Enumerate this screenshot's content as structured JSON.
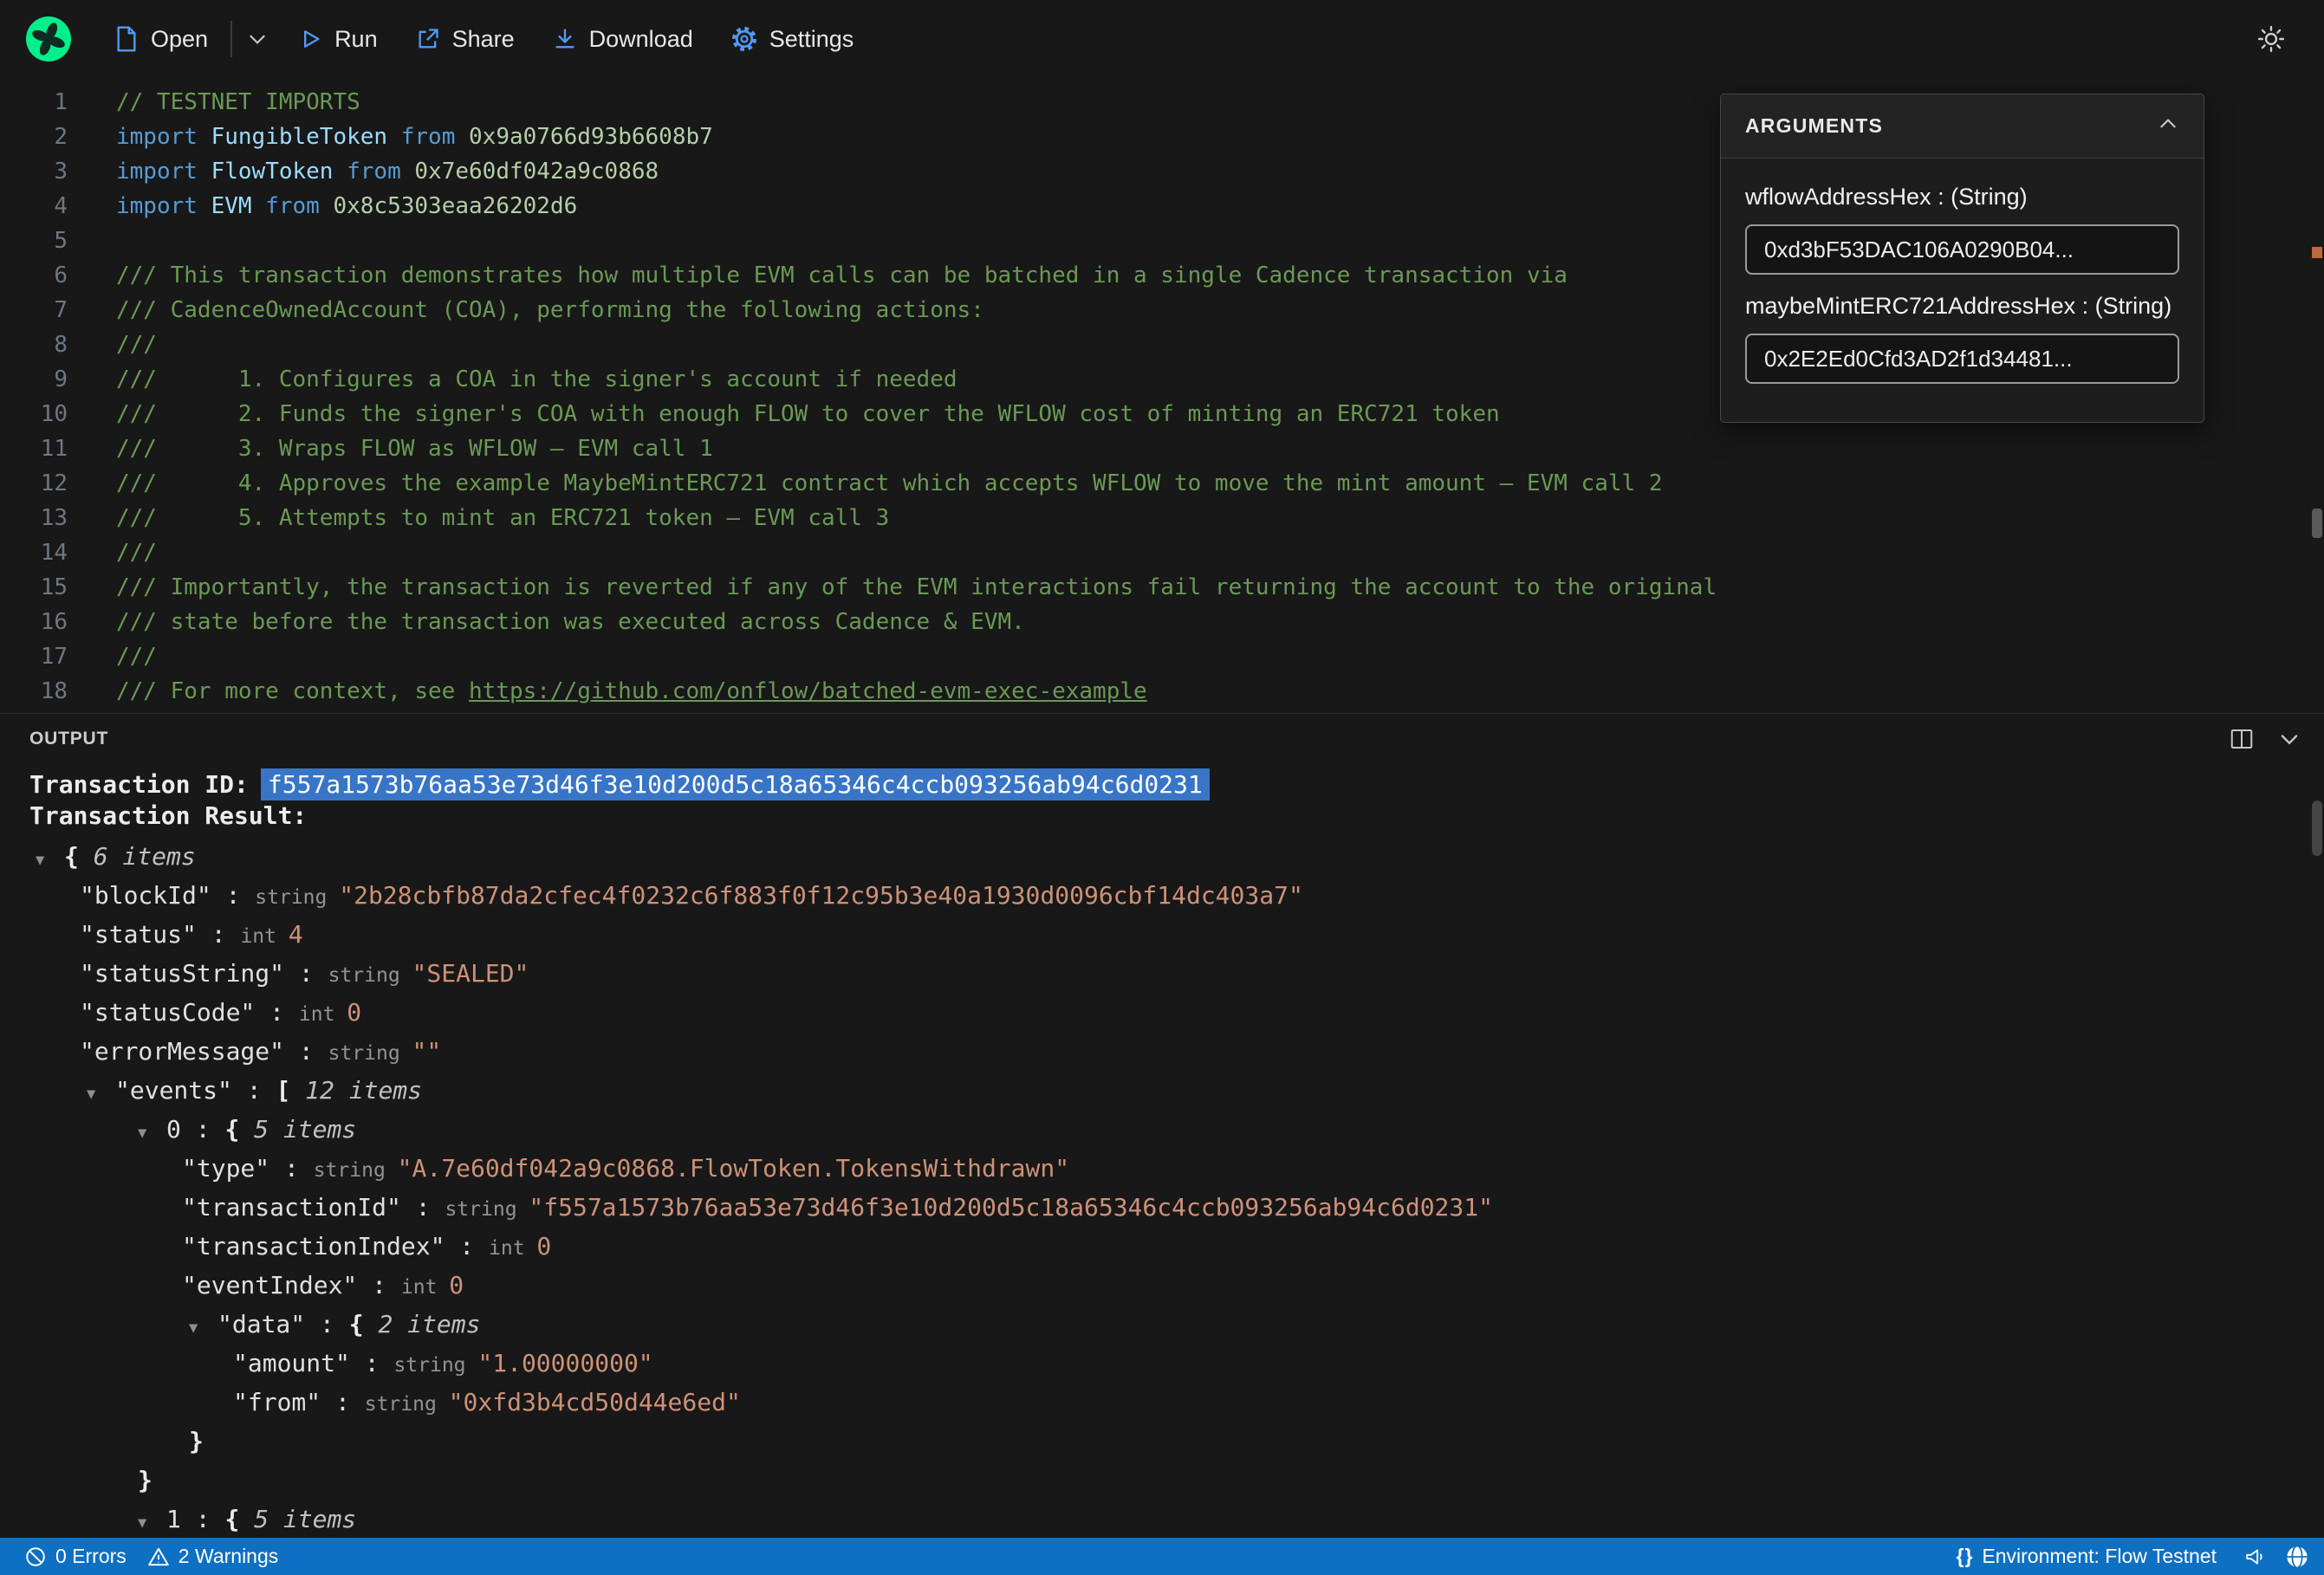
{
  "colors": {
    "brand_green": "#00ef8b",
    "icon_blue": "#519af5",
    "statusbar_blue": "#0e70c2",
    "selection_blue": "#3875c7",
    "comment_green": "#6a9955",
    "string_orange": "#ce9178"
  },
  "toolbar": {
    "open": "Open",
    "run": "Run",
    "share": "Share",
    "download": "Download",
    "settings": "Settings"
  },
  "editor": {
    "lines": [
      {
        "n": "1",
        "tokens": [
          [
            "c",
            "// TESTNET IMPORTS"
          ]
        ]
      },
      {
        "n": "2",
        "tokens": [
          [
            "k",
            "import "
          ],
          [
            "i",
            "FungibleToken "
          ],
          [
            "k",
            "from "
          ],
          [
            "a",
            "0x9a0766d93b6608b7"
          ]
        ]
      },
      {
        "n": "3",
        "tokens": [
          [
            "k",
            "import "
          ],
          [
            "i",
            "FlowToken "
          ],
          [
            "k",
            "from "
          ],
          [
            "a",
            "0x7e60df042a9c0868"
          ]
        ]
      },
      {
        "n": "4",
        "tokens": [
          [
            "k",
            "import "
          ],
          [
            "i",
            "EVM "
          ],
          [
            "k",
            "from "
          ],
          [
            "a",
            "0x8c5303eaa26202d6"
          ]
        ]
      },
      {
        "n": "5",
        "tokens": []
      },
      {
        "n": "6",
        "tokens": [
          [
            "c",
            "/// This transaction demonstrates how multiple EVM calls can be batched in a single Cadence transaction via"
          ]
        ]
      },
      {
        "n": "7",
        "tokens": [
          [
            "c",
            "/// CadenceOwnedAccount (COA), performing the following actions:"
          ]
        ]
      },
      {
        "n": "8",
        "tokens": [
          [
            "c",
            "///"
          ]
        ]
      },
      {
        "n": "9",
        "tokens": [
          [
            "c",
            "///      1. Configures a COA in the signer's account if needed"
          ]
        ]
      },
      {
        "n": "10",
        "tokens": [
          [
            "c",
            "///      2. Funds the signer's COA with enough FLOW to cover the WFLOW cost of minting an ERC721 token"
          ]
        ]
      },
      {
        "n": "11",
        "tokens": [
          [
            "c",
            "///      3. Wraps FLOW as WFLOW — EVM call 1"
          ]
        ]
      },
      {
        "n": "12",
        "tokens": [
          [
            "c",
            "///      4. Approves the example MaybeMintERC721 contract which accepts WFLOW to move the mint amount — EVM call 2"
          ]
        ]
      },
      {
        "n": "13",
        "tokens": [
          [
            "c",
            "///      5. Attempts to mint an ERC721 token — EVM call 3"
          ]
        ]
      },
      {
        "n": "14",
        "tokens": [
          [
            "c",
            "///"
          ]
        ]
      },
      {
        "n": "15",
        "tokens": [
          [
            "c",
            "/// Importantly, the transaction is reverted if any of the EVM interactions fail returning the account to the original"
          ]
        ]
      },
      {
        "n": "16",
        "tokens": [
          [
            "c",
            "/// state before the transaction was executed across Cadence & EVM."
          ]
        ]
      },
      {
        "n": "17",
        "tokens": [
          [
            "c",
            "///"
          ]
        ]
      },
      {
        "n": "18",
        "tokens": [
          [
            "c",
            "/// For more context, see "
          ],
          [
            "l",
            "https://github.com/onflow/batched-evm-exec-example"
          ]
        ]
      }
    ]
  },
  "arguments_panel": {
    "title": "ARGUMENTS",
    "fields": [
      {
        "label": "wflowAddressHex : (String)",
        "value": "0xd3bF53DAC106A0290B04..."
      },
      {
        "label": "maybeMintERC721AddressHex : (String)",
        "value": "0x2E2Ed0Cfd3AD2f1d34481..."
      }
    ]
  },
  "output": {
    "title": "OUTPUT",
    "transaction_id_label": "Transaction ID:",
    "transaction_id": "f557a1573b76aa53e73d46f3e10d200d5c18a65346c4ccb093256ab94c6d0231",
    "transaction_result_label": "Transaction Result:",
    "tree": [
      {
        "i": 0,
        "a": true,
        "seg": [
          [
            "punct",
            "{ "
          ],
          [
            "count",
            "6 items"
          ]
        ]
      },
      {
        "i": 1,
        "seg": [
          [
            "key",
            "\"blockId\""
          ],
          [
            "colon",
            " : "
          ],
          [
            "type",
            "string "
          ],
          [
            "str",
            "\"2b28cbfb87da2cfec4f0232c6f883f0f12c95b3e40a1930d0096cbf14dc403a7\""
          ]
        ]
      },
      {
        "i": 1,
        "seg": [
          [
            "key",
            "\"status\""
          ],
          [
            "colon",
            " : "
          ],
          [
            "type",
            "int "
          ],
          [
            "num",
            "4"
          ]
        ]
      },
      {
        "i": 1,
        "seg": [
          [
            "key",
            "\"statusString\""
          ],
          [
            "colon",
            " : "
          ],
          [
            "type",
            "string "
          ],
          [
            "str",
            "\"SEALED\""
          ]
        ]
      },
      {
        "i": 1,
        "seg": [
          [
            "key",
            "\"statusCode\""
          ],
          [
            "colon",
            " : "
          ],
          [
            "type",
            "int "
          ],
          [
            "num",
            "0"
          ]
        ]
      },
      {
        "i": 1,
        "seg": [
          [
            "key",
            "\"errorMessage\""
          ],
          [
            "colon",
            " : "
          ],
          [
            "type",
            "string "
          ],
          [
            "str",
            "\"\""
          ]
        ]
      },
      {
        "i": 1,
        "a": true,
        "seg": [
          [
            "key",
            "\"events\""
          ],
          [
            "colon",
            " : "
          ],
          [
            "punct",
            "[ "
          ],
          [
            "count",
            "12 items"
          ]
        ]
      },
      {
        "i": 2,
        "a": true,
        "seg": [
          [
            "key",
            "0"
          ],
          [
            "colon",
            " : "
          ],
          [
            "punct",
            "{ "
          ],
          [
            "count",
            "5 items"
          ]
        ]
      },
      {
        "i": 3,
        "seg": [
          [
            "key",
            "\"type\""
          ],
          [
            "colon",
            " : "
          ],
          [
            "type",
            "string "
          ],
          [
            "str",
            "\"A.7e60df042a9c0868.FlowToken.TokensWithdrawn\""
          ]
        ]
      },
      {
        "i": 3,
        "seg": [
          [
            "key",
            "\"transactionId\""
          ],
          [
            "colon",
            " : "
          ],
          [
            "type",
            "string "
          ],
          [
            "str",
            "\"f557a1573b76aa53e73d46f3e10d200d5c18a65346c4ccb093256ab94c6d0231\""
          ]
        ]
      },
      {
        "i": 3,
        "seg": [
          [
            "key",
            "\"transactionIndex\""
          ],
          [
            "colon",
            " : "
          ],
          [
            "type",
            "int "
          ],
          [
            "num",
            "0"
          ]
        ]
      },
      {
        "i": 3,
        "seg": [
          [
            "key",
            "\"eventIndex\""
          ],
          [
            "colon",
            " : "
          ],
          [
            "type",
            "int "
          ],
          [
            "num",
            "0"
          ]
        ]
      },
      {
        "i": 3,
        "a": true,
        "seg": [
          [
            "key",
            "\"data\""
          ],
          [
            "colon",
            " : "
          ],
          [
            "punct",
            "{ "
          ],
          [
            "count",
            "2 items"
          ]
        ]
      },
      {
        "i": 4,
        "seg": [
          [
            "key",
            "\"amount\""
          ],
          [
            "colon",
            " : "
          ],
          [
            "type",
            "string "
          ],
          [
            "str",
            "\"1.00000000\""
          ]
        ]
      },
      {
        "i": 4,
        "seg": [
          [
            "key",
            "\"from\""
          ],
          [
            "colon",
            " : "
          ],
          [
            "type",
            "string "
          ],
          [
            "str",
            "\"0xfd3b4cd50d44e6ed\""
          ]
        ]
      },
      {
        "i": 3,
        "c": true,
        "seg": [
          [
            "punct",
            "}"
          ]
        ]
      },
      {
        "i": 2,
        "c": true,
        "seg": [
          [
            "punct",
            "}"
          ]
        ]
      },
      {
        "i": 2,
        "a": true,
        "seg": [
          [
            "key",
            "1"
          ],
          [
            "colon",
            " : "
          ],
          [
            "punct",
            "{ "
          ],
          [
            "count",
            "5 items"
          ]
        ]
      }
    ]
  },
  "statusbar": {
    "errors": "0 Errors",
    "warnings": "2 Warnings",
    "braces": "{}",
    "environment": "Environment: Flow Testnet"
  }
}
